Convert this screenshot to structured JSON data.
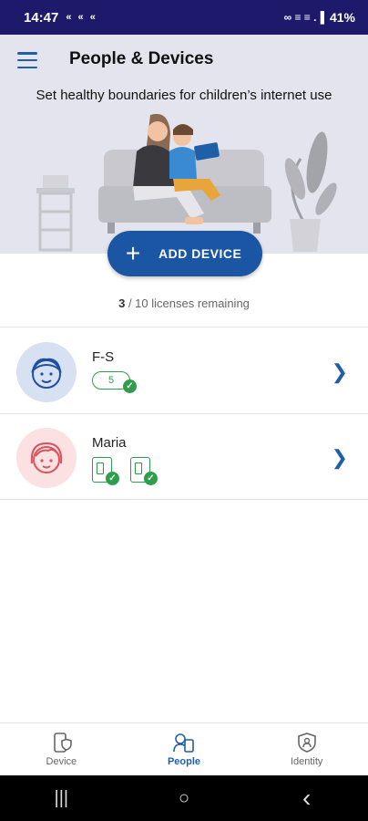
{
  "status_bar": {
    "time": "14:47",
    "notifications": "« « «",
    "right_icons": "∞ ≡ ≡ .▐",
    "battery": "41%"
  },
  "header": {
    "title": "People & Devices",
    "subtitle": "Set healthy boundaries for children’s internet use"
  },
  "add_device": {
    "label": "ADD DEVICE",
    "icon": "plus-icon"
  },
  "licenses": {
    "used": "3",
    "text": " / 10 licenses remaining"
  },
  "people": [
    {
      "name": "F-S",
      "avatar": "boy-avatar",
      "device_count": "5",
      "devices_shown": 0
    },
    {
      "name": "Maria",
      "avatar": "girl-avatar",
      "device_count": "",
      "devices_shown": 2
    }
  ],
  "bottom_nav": {
    "items": [
      {
        "label": "Device",
        "icon": "device-shield-icon",
        "active": false
      },
      {
        "label": "People",
        "icon": "people-icon",
        "active": true
      },
      {
        "label": "Identity",
        "icon": "identity-shield-icon",
        "active": false
      }
    ]
  },
  "system_nav": {
    "recent": "|||",
    "home": "○",
    "back": "‹"
  },
  "colors": {
    "status_bar": "#1d1a6b",
    "hero_bg": "#e4e4ee",
    "primary": "#1a56a3",
    "success": "#2e9e4a",
    "avatar_blue_bg": "#d8e1f2",
    "avatar_pink_bg": "#fbe1e1"
  }
}
